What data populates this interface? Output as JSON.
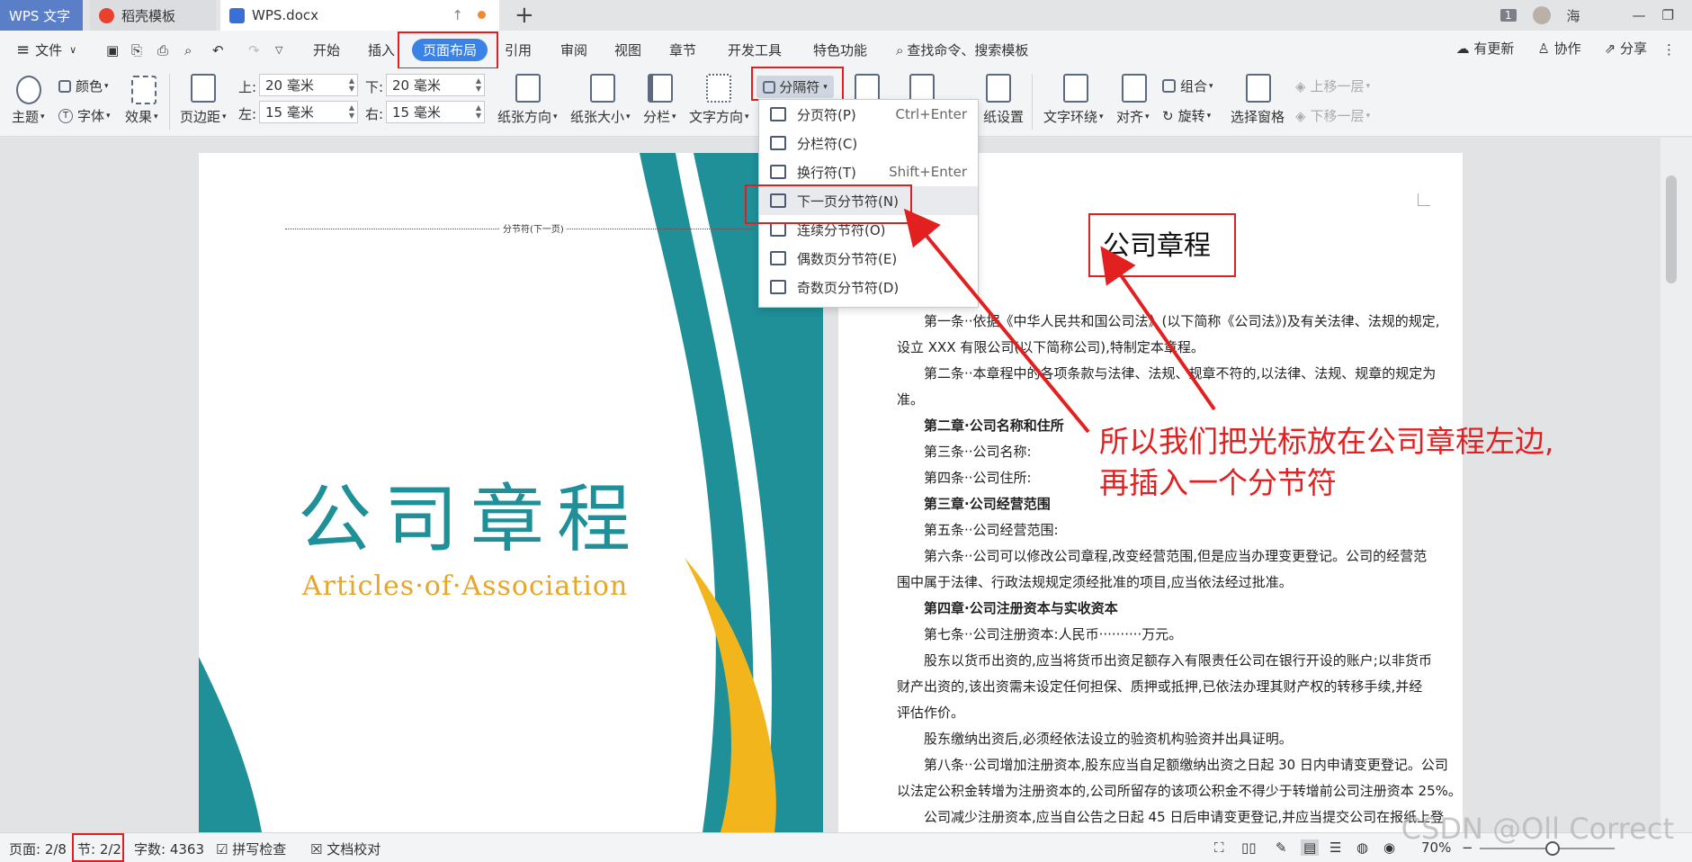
{
  "titlebar": {
    "app_tab": "WPS 文字",
    "template_tab": "稻壳模板",
    "doc_tab": "WPS.docx",
    "badge": "1",
    "user": "海"
  },
  "menubar": {
    "file": "文件",
    "items": [
      "开始",
      "插入",
      "页面布局",
      "引用",
      "审阅",
      "视图",
      "章节",
      "开发工具",
      "特色功能"
    ],
    "search": "查找命令、搜索模板",
    "right": [
      "有更新",
      "协作",
      "分享"
    ]
  },
  "ribbon": {
    "theme": "主题",
    "color": "颜色",
    "font": "字体",
    "effect": "效果",
    "margin": "页边距",
    "top_label": "上:",
    "top_value": "20 毫米",
    "bottom_label": "下:",
    "bottom_value": "20 毫米",
    "left_label": "左:",
    "left_value": "15 毫米",
    "right_label": "右:",
    "right_value": "15 毫米",
    "orientation": "纸张方向",
    "paper_size": "纸张大小",
    "columns": "分栏",
    "text_direction": "文字方向",
    "separator": "分隔符",
    "paper_settings": "纸设置",
    "text_wrap": "文字环绕",
    "align": "对齐",
    "group": "组合",
    "rotate": "旋转",
    "select_pane": "选择窗格",
    "bring_forward": "上移一层",
    "send_backward": "下移一层"
  },
  "dropdown": {
    "items": [
      {
        "label": "分页符(P)",
        "shortcut": "Ctrl+Enter"
      },
      {
        "label": "分栏符(C)",
        "shortcut": ""
      },
      {
        "label": "换行符(T)",
        "shortcut": "Shift+Enter"
      },
      {
        "label": "下一页分节符(N)",
        "shortcut": ""
      },
      {
        "label": "连续分节符(O)",
        "shortcut": ""
      },
      {
        "label": "偶数页分节符(E)",
        "shortcut": ""
      },
      {
        "label": "奇数页分节符(D)",
        "shortcut": ""
      }
    ]
  },
  "left_page": {
    "section_marker": "分节符(下一页)",
    "title": "公司章程",
    "subtitle": "Articles·of·Association"
  },
  "right_page": {
    "heading": "公司章程",
    "lines": [
      {
        "text": "第一条··依据《中华人民共和国公司法》(以下简称《公司法》)及有关法律、法规的规定,",
        "indent": true,
        "bold": false
      },
      {
        "text": "设立 XXX 有限公司(以下简称公司),特制定本章程。",
        "indent": false,
        "bold": false
      },
      {
        "text": "第二条··本章程中的各项条款与法律、法规、规章不符的,以法律、法规、规章的规定为",
        "indent": true,
        "bold": false
      },
      {
        "text": "准。",
        "indent": false,
        "bold": false
      },
      {
        "text": "第二章·公司名称和住所",
        "indent": true,
        "bold": true
      },
      {
        "text": "第三条··公司名称:",
        "indent": true,
        "bold": false
      },
      {
        "text": "第四条··公司住所:",
        "indent": true,
        "bold": false
      },
      {
        "text": "第三章·公司经营范围",
        "indent": true,
        "bold": true
      },
      {
        "text": "第五条··公司经营范围:",
        "indent": true,
        "bold": false
      },
      {
        "text": "第六条··公司可以修改公司章程,改变经营范围,但是应当办理变更登记。公司的经营范",
        "indent": true,
        "bold": false
      },
      {
        "text": "围中属于法律、行政法规规定须经批准的项目,应当依法经过批准。",
        "indent": false,
        "bold": false
      },
      {
        "text": "第四章·公司注册资本与实收资本",
        "indent": true,
        "bold": true
      },
      {
        "text": "第七条··公司注册资本:人民币··········万元。",
        "indent": true,
        "bold": false
      },
      {
        "text": "股东以货币出资的,应当将货币出资足额存入有限责任公司在银行开设的账户;以非货币",
        "indent": true,
        "bold": false
      },
      {
        "text": "财产出资的,该出资需未设定任何担保、质押或抵押,已依法办理其财产权的转移手续,并经",
        "indent": false,
        "bold": false
      },
      {
        "text": "评估作价。",
        "indent": false,
        "bold": false
      },
      {
        "text": "股东缴纳出资后,必须经依法设立的验资机构验资并出具证明。",
        "indent": true,
        "bold": false
      },
      {
        "text": "第八条··公司增加注册资本,股东应当自足额缴纳出资之日起 30 日内申请变更登记。公司",
        "indent": true,
        "bold": false
      },
      {
        "text": "以法定公积金转增为注册资本的,公司所留存的该项公积金不得少于转增前公司注册资本 25%。",
        "indent": false,
        "bold": false
      },
      {
        "text": "公司减少注册资本,应当自公告之日起 45 日后申请变更登记,并应当提交公司在报纸上登",
        "indent": true,
        "bold": false
      }
    ]
  },
  "annotation": {
    "line1": "所以我们把光标放在公司章程左边,",
    "line2": "再插入一个分节符"
  },
  "statusbar": {
    "page": "页面: 2/8",
    "section": "节: 2/2",
    "words": "字数: 4363",
    "spell": "拼写检查",
    "proof": "文档校对",
    "zoom": "70%"
  },
  "watermark": "CSDN @Oll Correct",
  "colors": {
    "accent": "#3b82e6",
    "annotation": "#e22020",
    "cover_teal": "#1f8f98",
    "cover_gold": "#e7a52a"
  }
}
